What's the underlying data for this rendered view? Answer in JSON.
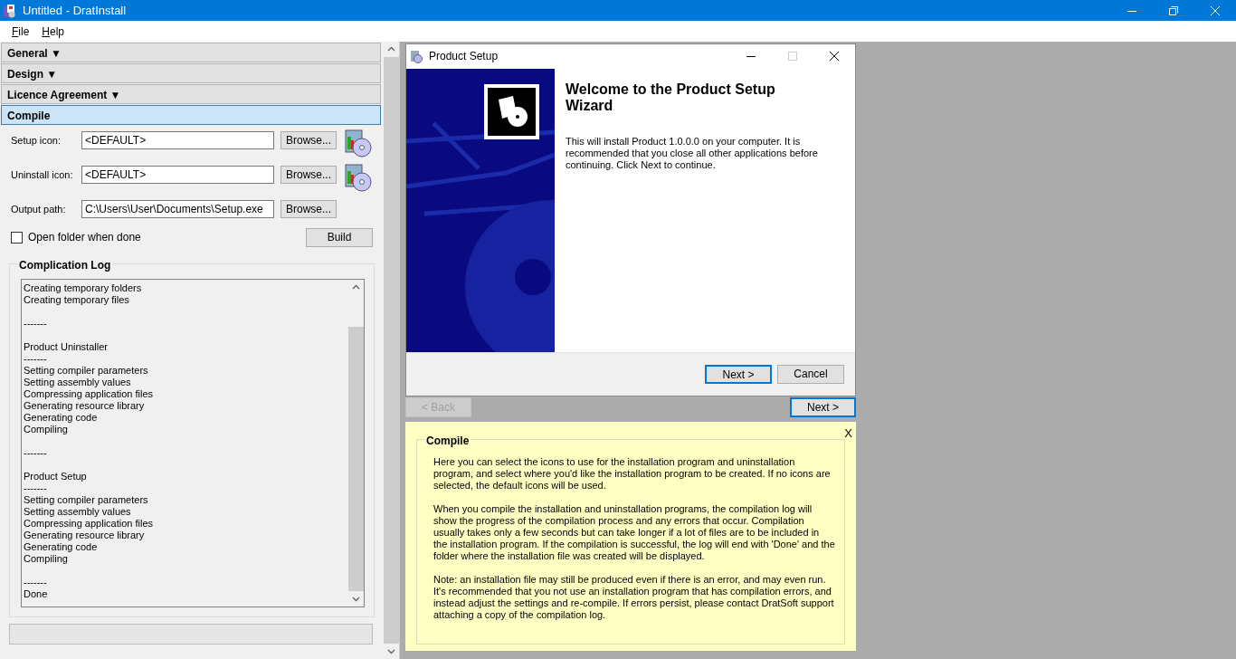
{
  "window": {
    "title": "Untitled - DratInstall"
  },
  "menu": [
    {
      "label": "File"
    },
    {
      "label": "Help"
    }
  ],
  "sections": [
    {
      "label": "General ▼",
      "expanded": false
    },
    {
      "label": "Design ▼",
      "expanded": false
    },
    {
      "label": "Licence Agreement ▼",
      "expanded": false
    },
    {
      "label": "Compile",
      "expanded": true
    }
  ],
  "fields": [
    {
      "label": "Setup icon:",
      "value": "<DEFAULT>",
      "button": "Browse...",
      "kind": "icon"
    },
    {
      "label": "Uninstall icon:",
      "value": "<DEFAULT>",
      "button": "Browse...",
      "kind": "icon"
    },
    {
      "label": "Output path:",
      "value": "C:\\Users\\User\\Documents\\Setup.exe",
      "button": "Browse...",
      "kind": "path"
    }
  ],
  "open_folder": {
    "label": "Open folder when done",
    "checked": false
  },
  "build_button": "Build",
  "log": {
    "title": "Complication Log",
    "text": "Creating temporary folders\nCreating temporary files\n\n-------\n\nProduct Uninstaller\n-------\nSetting compiler parameters\nSetting assembly values\nCompressing application files\nGenerating resource library\nGenerating code\nCompiling\n\n-------\n\nProduct Setup\n-------\nSetting compiler parameters\nSetting assembly values\nCompressing application files\nGenerating resource library\nGenerating code\nCompiling\n\n-------\nDone"
  },
  "progress": {
    "level": 0
  },
  "wizard": {
    "title": "Product Setup",
    "heading": "Welcome to the Product Setup Wizard",
    "body": "This will install Product 1.0.0.0 on your computer. It is recommended that you close all other applications before continuing. Click Next to continue.",
    "buttons": [
      {
        "label": "Next >",
        "selected": true
      },
      {
        "label": "Cancel",
        "selected": false
      }
    ]
  },
  "nav_buttons": [
    {
      "label": "< Back",
      "disabled": true,
      "selected": false
    },
    {
      "label": "Next >",
      "disabled": false,
      "selected": true
    }
  ],
  "help": {
    "close": "X",
    "title": "Compile",
    "paragraphs": [
      "Here you can select the icons to use for the installation program and uninstallation program, and select where you'd like the installation program to be created. If no icons are selected, the default icons will be used.",
      "When you compile the installation and uninstallation programs, the compilation log will show the progress of the compilation process and any errors that occur. Compilation usually takes only a few seconds but can take longer if a lot of files are to be included in the installation program. If the compilation is successful, the log will end with 'Done' and the folder where the installation file was created will be displayed.",
      "Note: an installation file may still be produced even if there is an error, and may even run. It's recommended that you not use an installation program that has compilation errors, and instead adjust the settings and re-compile. If errors persist, please contact DratSoft support attaching a copy of the compilation log."
    ]
  }
}
